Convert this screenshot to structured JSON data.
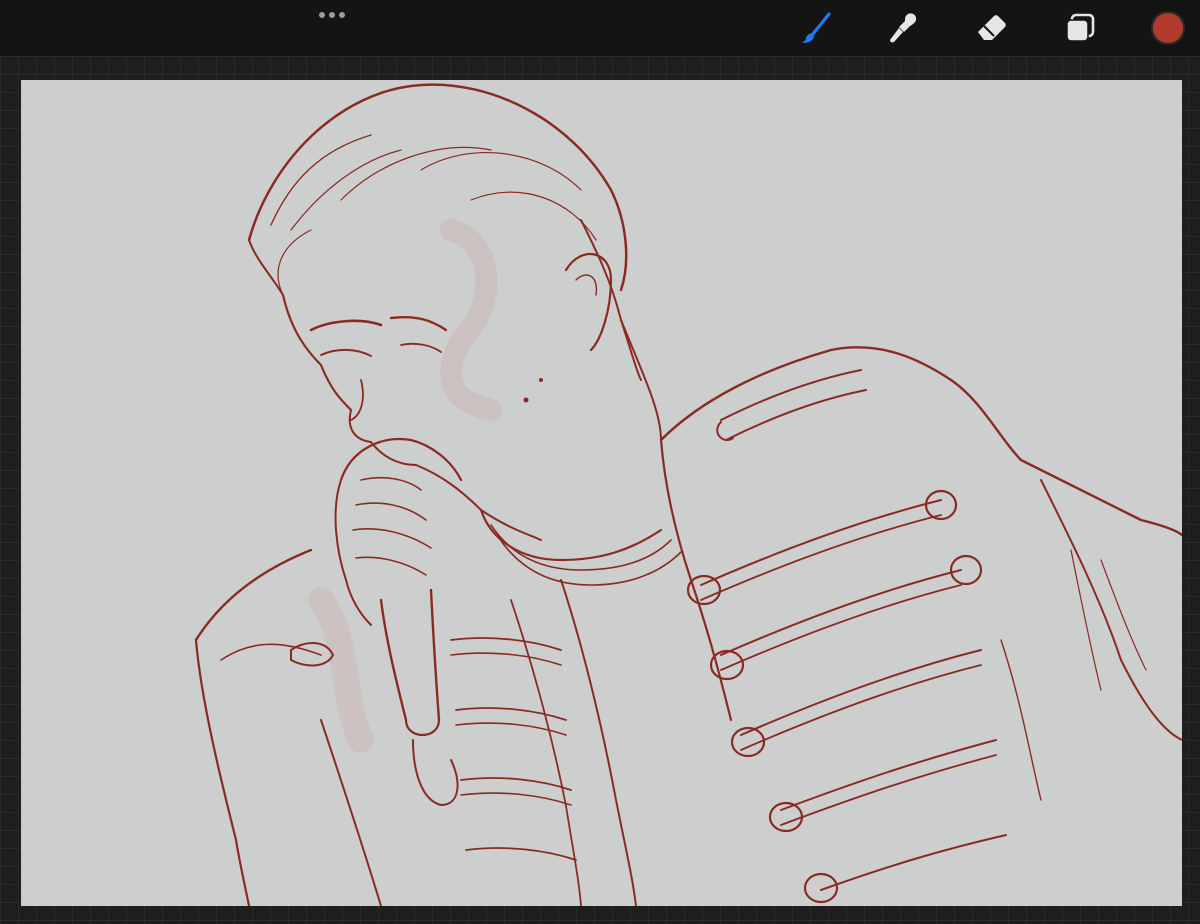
{
  "app": {
    "toolbar": {
      "more_icon": "more-horizontal-icon",
      "tools": [
        {
          "name": "brush",
          "icon": "brush-icon",
          "active": true
        },
        {
          "name": "smudge",
          "icon": "smudge-icon",
          "active": false
        },
        {
          "name": "eraser",
          "icon": "eraser-icon",
          "active": false
        },
        {
          "name": "layers",
          "icon": "layers-icon",
          "active": false
        }
      ],
      "current_color": "#b23a2c",
      "active_tool_color": "#1e7cf2",
      "inactive_tool_color": "#e6e6e6"
    },
    "canvas": {
      "background": "#cdcfcf",
      "line_color": "#8a2b22",
      "content": "line-art-sketch"
    }
  }
}
